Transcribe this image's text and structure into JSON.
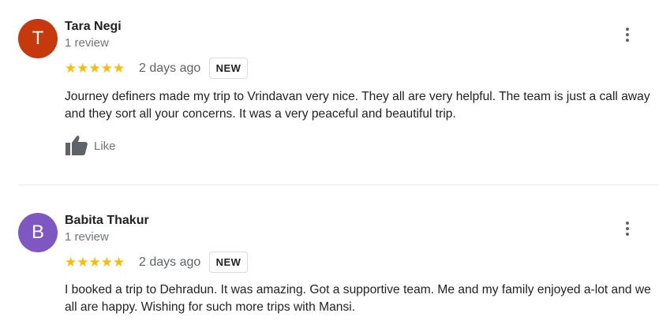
{
  "reviews": [
    {
      "avatar_letter": "T",
      "avatar_color": "#c5390d",
      "name": "Tara Negi",
      "review_count": "1 review",
      "stars": "★★★★★",
      "rating": 5,
      "time_ago": "2 days ago",
      "badge": "NEW",
      "text": "Journey definers made my trip to Vrindavan very nice. They all are very helpful. The team is just a call away and they sort all your concerns. It was a very peaceful and beautiful trip.",
      "like_label": "Like"
    },
    {
      "avatar_letter": "B",
      "avatar_color": "#7e57c2",
      "name": "Babita Thakur",
      "review_count": "1 review",
      "stars": "★★★★★",
      "rating": 5,
      "time_ago": "2 days ago",
      "badge": "NEW",
      "text": "I booked a trip to Dehradun. It was amazing. Got a supportive team. Me and my family enjoyed a-lot and we all are happy. Wishing for such more trips with Mansi."
    }
  ],
  "colors": {
    "star": "#fbbc04",
    "secondary_text": "#70757a",
    "divider": "#e8eaed"
  },
  "icons": {
    "more": "more-vert-icon",
    "like": "thumbs-up-icon",
    "star": "star-icon"
  }
}
